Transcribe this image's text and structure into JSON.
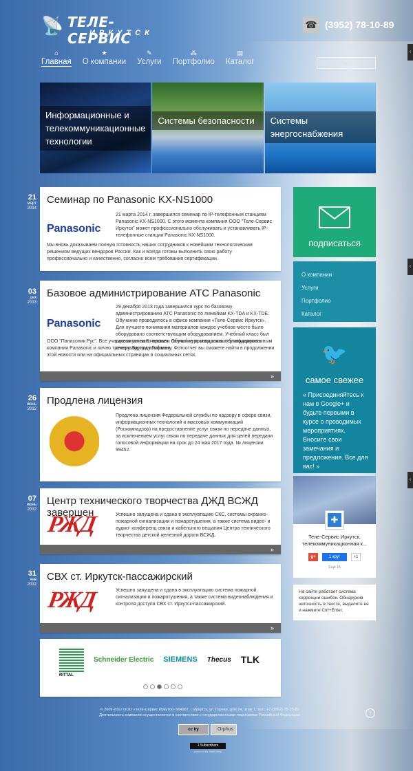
{
  "header": {
    "logo_line1": "ТЕЛЕ-СЕРВИС",
    "logo_line2": "ИРКУТСК",
    "phone": "(3952) 78-10-89",
    "search_placeholder": "искать"
  },
  "nav": [
    {
      "label": "Главная",
      "icon": "home-icon"
    },
    {
      "label": "О компании",
      "icon": "star-icon"
    },
    {
      "label": "Услуги",
      "icon": "wrench-icon"
    },
    {
      "label": "Портфолио",
      "icon": "network-icon"
    },
    {
      "label": "Каталог",
      "icon": "book-icon"
    }
  ],
  "tiles": [
    {
      "caption": "Информационные и телекоммуникационные технологии"
    },
    {
      "caption": "Системы безопасности"
    },
    {
      "caption": "Системы энергоснабжения"
    }
  ],
  "posts": [
    {
      "day": "21",
      "month": "март",
      "year": "2014",
      "title": "Семинар по Panasonic KX-NS1000",
      "logo": "Panasonic",
      "text1": "21 марта 2014 г. завершился семинар по IP-телефонным станциям Panasonic KX-NS1000. С этого момента компания ООО \"Теле-Сервис Иркутск\" может профессионально обслуживать и устанавливать IP-телефонные станции Panasonic KX-NS1000.",
      "text2": "Мы вновь доказываем полную готовность наших сотрудников к новейшим технологическим решениям ведущих вендоров России. Как и всегда готовы выполнить свою работу профессионально и качественно, согласно всем требования сертификации."
    },
    {
      "day": "03",
      "month": "дек",
      "year": "2013",
      "title": "Базовое администрирование АТС Panasonic",
      "logo": "Panasonic",
      "text1": "29 декабря 2013 года завершился курс по базовому администрированию АТС Panasonic по линейкам KX-TDA и KX-TDE. Обучение проводилось в офисе компании «Теле-Сервис Иркутск». Для лучшего понимания материалов каждое учебное место было оборудовано соответствующим оборудованием. Учебный класс был рассчитан на 5 человек. Обучение проводилось сертифицированным специалистом компании",
      "text2": "ООО \"Панасоник Рус\". Все учащиеся успешно прошли полный курс и выражают благодарность компании Panasonic и лично тренеру Эдуарду Гофману. Фотоотчет вы сможете найти в продолжении этой новости или на официальных страницах в социальных сетях."
    },
    {
      "day": "26",
      "month": "июнь",
      "year": "2012",
      "title": "Продлена лицензия",
      "logo": "emblem",
      "text1": "Продлена лицензия Федеральной службы по надзору в сфере связи, информационных технологий и массовых коммуникаций (Роскомнадзор) на предоставление услуг связи по передаче данных, за исключением услуг связи по передаче данных для целей передачи голосовой информации на срок до 24 мая 2017 года. № лицензии 99452.",
      "text2": ""
    },
    {
      "day": "07",
      "month": "июнь",
      "year": "2012",
      "title": "Центр технического творчества ДЖД ВСЖД завершен",
      "logo": "РЖД",
      "text1": "Успешно запущена и сдана в эксплуатацию СКС, системы охранно-пожарной сигнализации и пожаротушения, а также система видео- и аудио- конференц связи и кабельного вещания Центра технического творчества детской железной дороги ВСЖД.",
      "text2": ""
    },
    {
      "day": "31",
      "month": "янв",
      "year": "2012",
      "title": "СВХ ст. Иркутск-пассажирский",
      "logo": "РЖД",
      "text1": "Успешно запущена и сдана в эксплуатацию система пожарной сигнализации и пожаротушения, а также система видеонаблюдения и контроля доступа СВХ ст. Иркутск-пассажирский.",
      "text2": ""
    }
  ],
  "partners": [
    "RITTAL",
    "Schneider Electric",
    "SIEMENS",
    "Thecus",
    "TLK"
  ],
  "sidebar": {
    "subscribe": "подписаться",
    "menu": [
      "О компании",
      "Услуги",
      "Портфолио",
      "Каталог"
    ],
    "twitter_title": "самое свежее",
    "twitter_text": "« Присоединяйтесь к нам в Google+ и будьте первыми в курсе о проводимых мероприятиях. Вносите свои замечания и предложения. Все для вас! »",
    "gplus_name": "Теле-Сервис Иркутск, телекоммуникационная к...",
    "gplus_circle": "1 круг",
    "gplus_plus": "+1",
    "gplus_count": "Ещё 18",
    "orphus_text": "На сайте работает система коррекции ошибок. Обнаружив неточность в тексте, выделите ее и нажмите Ctrl+Enter."
  },
  "footer": {
    "line1": "© 2009-2012 ООО «Теле-Сервис Иркутск» 664007, г. Иркутск, ул. Горная, дом 24, этаж 7, тел.: +7 (3952) 78-10-89",
    "line2": "Деятельность компании осуществляется в соответствии с государственными лицензиями Российской Федерации",
    "orphus": "Orphus",
    "subscribers": "1 Subscribers",
    "powered": "powered by MailChimp"
  }
}
